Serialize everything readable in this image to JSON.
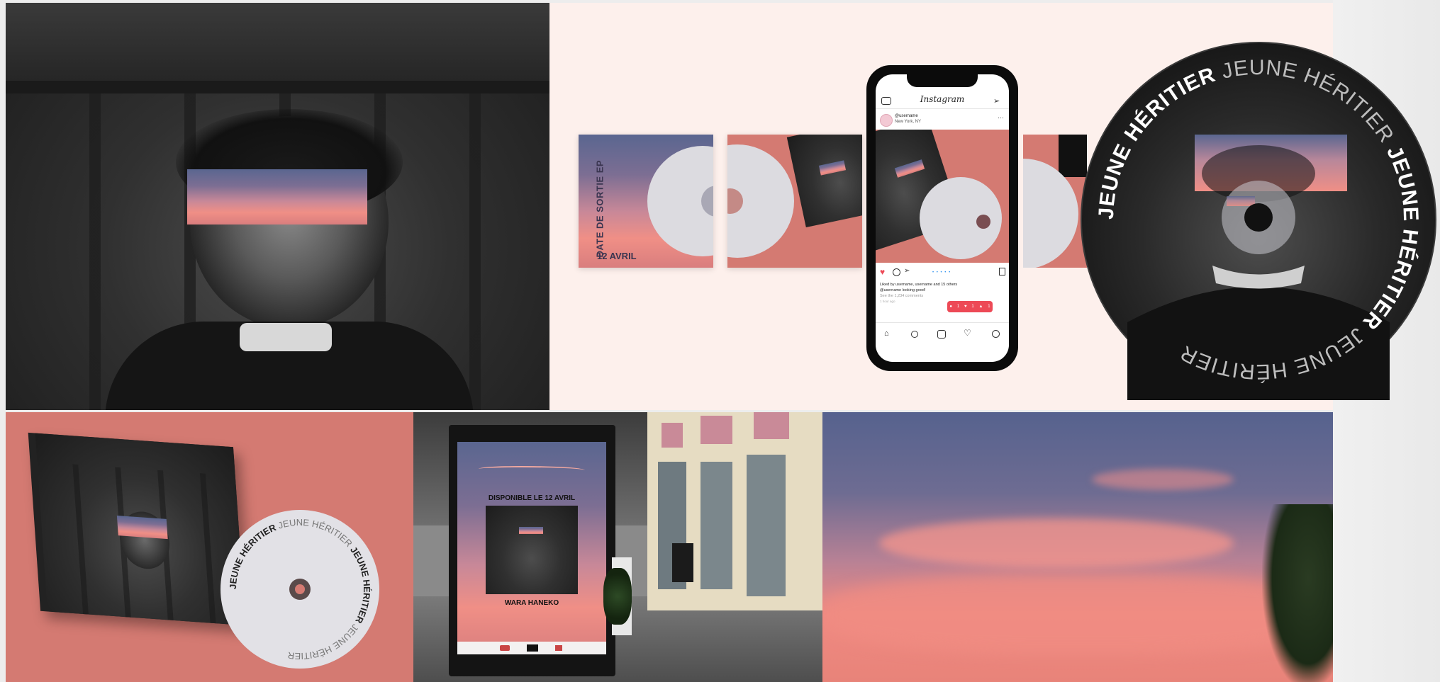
{
  "cd": {
    "text_bold": "JEUNE HÉRITIER",
    "text_light": "JEUNE HÉRITIER"
  },
  "cover_back": {
    "release_label": "DATE DE SORTIE EP",
    "release_date": "12 AVRIL"
  },
  "instagram": {
    "app_name": "Instagram",
    "username": "@username",
    "location": "New York, NY",
    "likes_text": "Liked by username, username and 15 others",
    "caption": "@username looking good!",
    "comments_link": "See the 1,234 comments",
    "time_ago": "1 hour ago",
    "notif_comments": "1",
    "notif_likes": "1",
    "notif_follows": "1"
  },
  "poster": {
    "headline": "DISPONIBLE LE 12 AVRIL",
    "artist": "WARA HANEKO"
  },
  "colors": {
    "salmon": "#d47a72",
    "blush": "#fdf0ec",
    "sky_blue": "#5a6690",
    "sky_pink": "#f08f86",
    "insta_red": "#ed4956"
  }
}
